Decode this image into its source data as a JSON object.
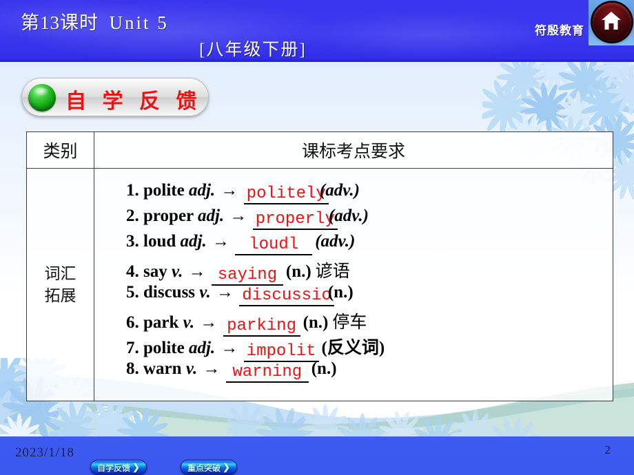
{
  "header": {
    "lesson": "第13课时",
    "unit": "Unit 5",
    "subtitle": "[八年级下册]",
    "brand": "符殷教育",
    "home_icon": "home-icon",
    "bg_color": "#3a36ee",
    "text_color": "#ffffff"
  },
  "banner": {
    "label": "自 学 反 馈",
    "text_color": "#f01111",
    "bullet_color": "#10a810"
  },
  "table": {
    "headers": [
      "类别",
      "课标考点要求"
    ],
    "category": "词汇\n拓展",
    "category_line1": "词汇",
    "category_line2": "拓展",
    "answer_color": "#ee1111",
    "items": [
      {
        "num": "1.",
        "word": "polite",
        "pos": "adj.",
        "arrow": "→",
        "answer": "politely",
        "tail": "(adv.)",
        "tail_italic": true,
        "cn": ""
      },
      {
        "num": "2.",
        "word": "proper",
        "pos": "adj.",
        "arrow": "→",
        "answer": "properly",
        "tail": "(adv.)",
        "tail_italic": true,
        "cn": ""
      },
      {
        "num": "3.",
        "word": "loud",
        "pos": "adj.",
        "arrow": "→",
        "answer": "loudl",
        "tail": "(adv.)",
        "tail_italic": true,
        "cn": ""
      },
      {
        "num": "4.",
        "word": "say",
        "pos": "v.",
        "arrow": "→",
        "answer": "saying",
        "tail": "(n.)",
        "tail_italic": false,
        "cn": "谚语"
      },
      {
        "num": "5.",
        "word": "discuss",
        "pos": "v.",
        "arrow": "→",
        "answer": "discussio",
        "tail": "(n.)",
        "tail_italic": false,
        "cn": ""
      },
      {
        "num": "6.",
        "word": "park",
        "pos": "v.",
        "arrow": "→",
        "answer": "parking",
        "tail": "(n.)",
        "tail_italic": false,
        "cn": "停车"
      },
      {
        "num": "7.",
        "word": "polite",
        "pos": "adj.",
        "arrow": "→",
        "answer": "impolit",
        "tail": "(反义词)",
        "tail_italic": false,
        "cn": ""
      },
      {
        "num": "8.",
        "word": "warn",
        "pos": "v.",
        "arrow": "→",
        "answer": "warning",
        "tail": "(n.)",
        "tail_italic": false,
        "cn": ""
      }
    ]
  },
  "footer": {
    "date": "2023/1/18",
    "page_number": "2",
    "buttons": [
      {
        "label": "自学反馈",
        "chevron": "❯"
      },
      {
        "label": "重点突破",
        "chevron": "❯"
      }
    ]
  }
}
